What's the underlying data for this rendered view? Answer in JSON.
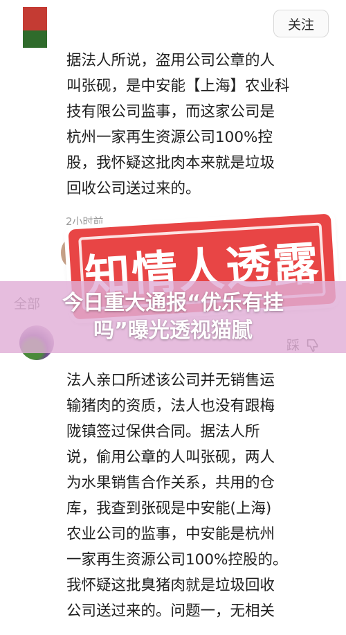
{
  "header": {
    "follow_label": "关注"
  },
  "comment1": {
    "lines": [
      "据法人所说，盗用公司公章的人",
      "叫张砚，是中安能【上海】农业科",
      "技有限公司监事，而这家公司是",
      "杭州一家再生资源公司100%控",
      "股，我怀疑这批肉本来就是垃圾",
      "回收公司送过来的。"
    ],
    "time": "2小时前"
  },
  "overlay": {
    "stamp_text": "知情人透露",
    "banner_line1": "今日重大通报“优乐有挂",
    "banner_line2": "吗”曝光透视猫腻"
  },
  "section": {
    "all_label": "全部"
  },
  "comment2": {
    "step_label": "踩",
    "lines": [
      "法人亲口所述该公司并无销售运",
      "输猪肉的资质，法人也没有跟梅",
      "陇镇签过保供合同。据法人所",
      "说，偷用公章的人叫张砚，两人",
      "为水果销售合作关系，共用的仓",
      "库，我查到张砚是中安能(上海)",
      "农业公司的监事，中安能是杭州",
      "一家再生资源公司100%控股的。",
      "我怀疑这批臭猪肉就是垃圾回收",
      "公司送过来的。问题一，无相关"
    ]
  },
  "colors": {
    "stamp_red": "#e84545",
    "banner_pink": "#e1afd7"
  }
}
